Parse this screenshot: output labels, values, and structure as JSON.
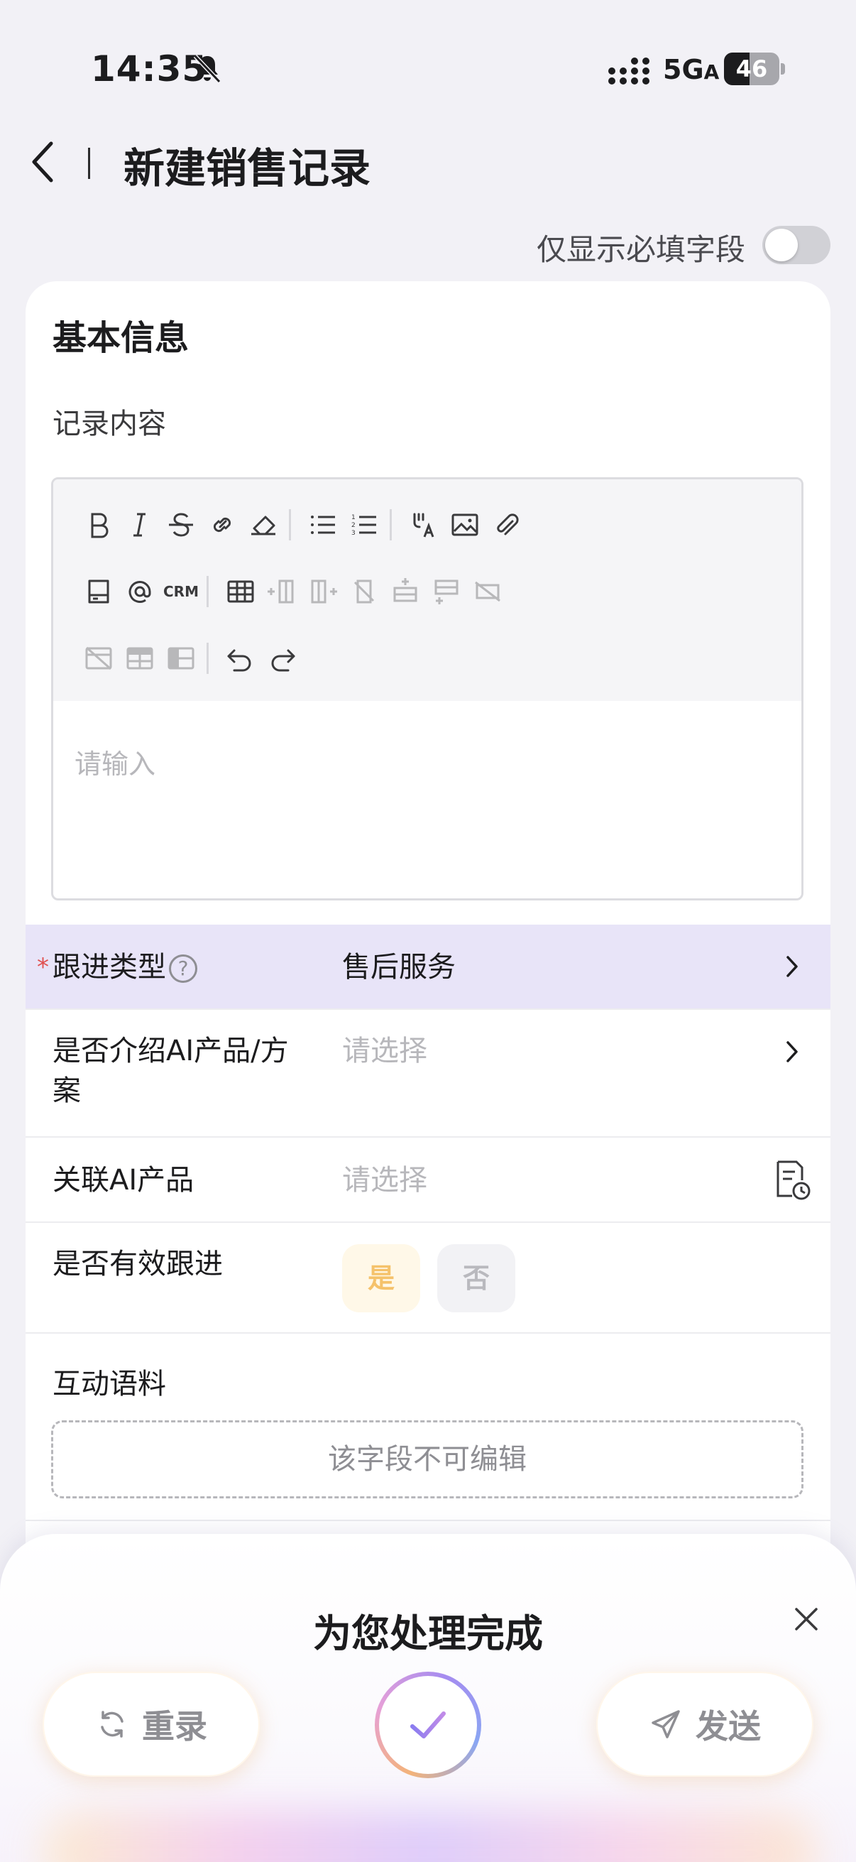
{
  "status_bar": {
    "time": "14:35",
    "network": "5G",
    "network_suffix": "A",
    "battery": "46",
    "battery_level": 0.46
  },
  "header": {
    "title": "新建销售记录",
    "back_icon": "chevron-left-icon"
  },
  "filter": {
    "required_only_label": "仅显示必填字段",
    "required_only_on": false
  },
  "form": {
    "section_title": "基本信息",
    "record_content": {
      "label": "记录内容",
      "placeholder": "请输入",
      "toolbar": [
        "bold-icon",
        "italic-icon",
        "strikethrough-icon",
        "link-icon",
        "eraser-icon",
        "bullet-list-icon",
        "numbered-list-icon",
        "translate-icon",
        "image-icon",
        "attachment-icon",
        "drive-icon",
        "mention-icon",
        "crm-icon",
        "table-icon",
        "insert-col-before-icon",
        "insert-col-after-icon",
        "delete-col-icon",
        "insert-row-before-icon",
        "insert-row-after-icon",
        "delete-row-icon",
        "delete-table-icon",
        "merge-cells-icon",
        "split-cells-icon",
        "undo-icon",
        "redo-icon"
      ],
      "crm_label": "CRM"
    },
    "follow_type": {
      "label": "跟进类型",
      "value": "售后服务",
      "required": true,
      "help": "?"
    },
    "introduce_ai": {
      "label_line1": "是否介绍AI产品/方",
      "label_line2": "案",
      "placeholder": "请选择"
    },
    "related_ai": {
      "label": "关联AI产品",
      "placeholder": "请选择"
    },
    "effective": {
      "label": "是否有效跟进",
      "yes": "是",
      "no": "否"
    },
    "corpus": {
      "label": "互动语料",
      "readonly_text": "该字段不可编辑"
    }
  },
  "sheet": {
    "title": "为您处理完成",
    "rerecord": "重录",
    "send": "发送"
  },
  "colors": {
    "highlight_row": "#e8e4f8",
    "yes_text": "#f5c26b",
    "required_star": "#e05050"
  }
}
